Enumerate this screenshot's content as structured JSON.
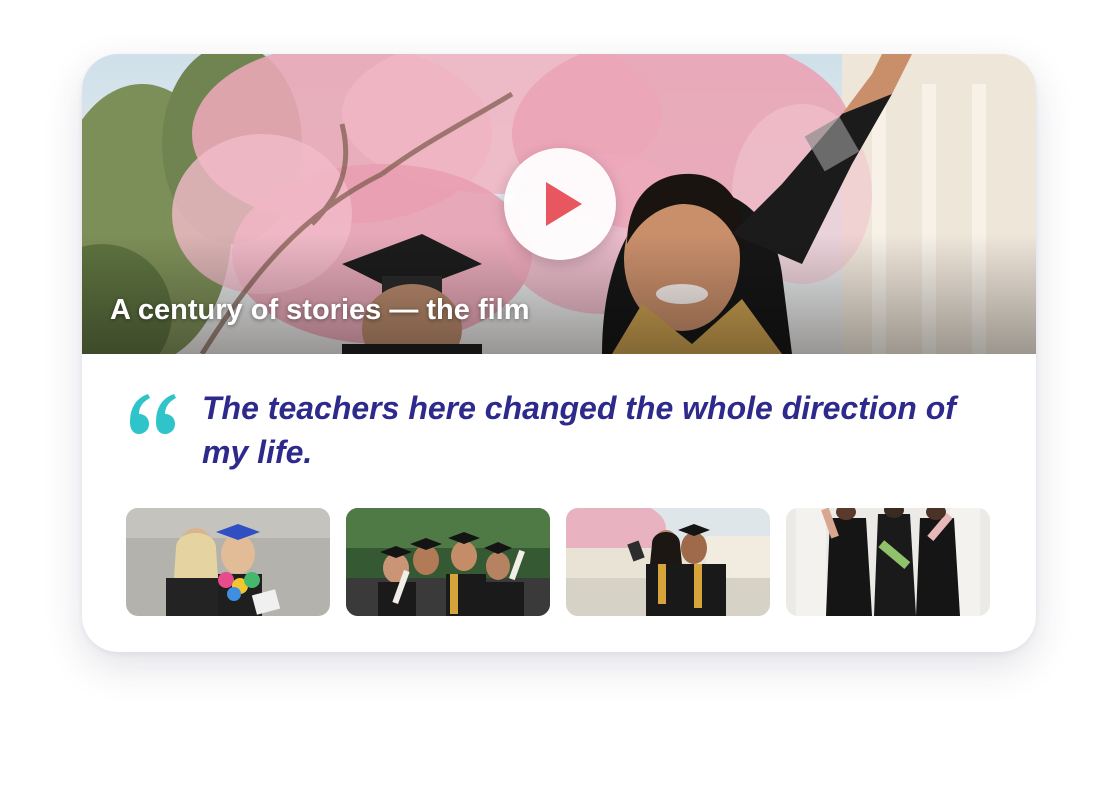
{
  "hero": {
    "caption": "A century of stories — the film",
    "image": "graduates-celebrating-under-blossoms",
    "play_icon": "play-icon"
  },
  "testimonial": {
    "quote_icon": "quote-mark-icon",
    "quote": "The teachers here changed the whole direction of my life."
  },
  "thumbnails": [
    {
      "image": "two-graduates-with-leis"
    },
    {
      "image": "group-of-graduates-with-diplomas"
    },
    {
      "image": "graduates-taking-selfie"
    },
    {
      "image": "graduates-holding-diplomas-indoors"
    }
  ],
  "colors": {
    "quote_text": "#2e2a8c",
    "quote_mark": "#2ec4c9",
    "play_icon": "#e8575f"
  }
}
